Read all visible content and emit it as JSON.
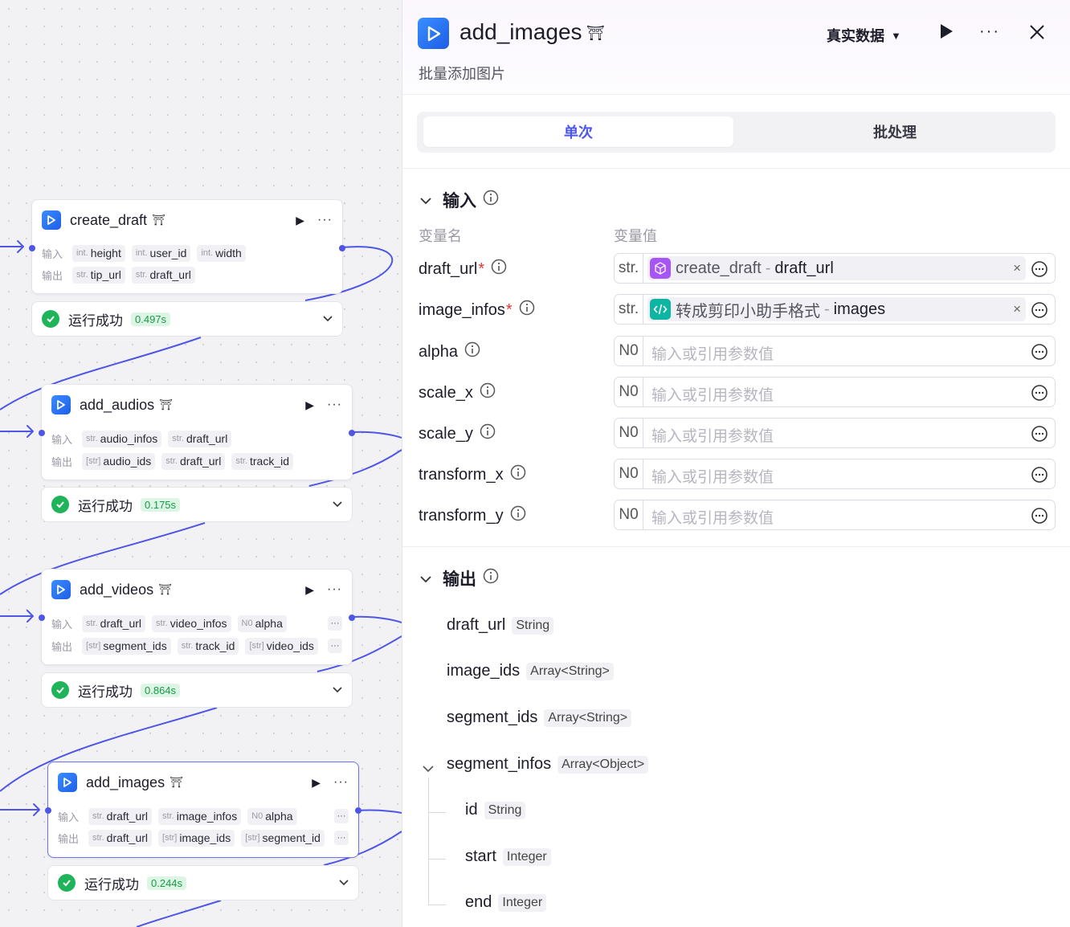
{
  "canvas": {
    "nodes": [
      {
        "title": "create_draft",
        "input_label": "输入",
        "output_label": "输出",
        "inputs": [
          {
            "type": "int.",
            "name": "height"
          },
          {
            "type": "int.",
            "name": "user_id"
          },
          {
            "type": "int.",
            "name": "width"
          }
        ],
        "outputs": [
          {
            "type": "str.",
            "name": "tip_url"
          },
          {
            "type": "str.",
            "name": "draft_url"
          }
        ],
        "status": "运行成功",
        "time": "0.497s"
      },
      {
        "title": "add_audios",
        "input_label": "输入",
        "output_label": "输出",
        "inputs": [
          {
            "type": "str.",
            "name": "audio_infos"
          },
          {
            "type": "str.",
            "name": "draft_url"
          }
        ],
        "outputs": [
          {
            "type": "[str]",
            "name": "audio_ids"
          },
          {
            "type": "str.",
            "name": "draft_url"
          },
          {
            "type": "str.",
            "name": "track_id"
          }
        ],
        "status": "运行成功",
        "time": "0.175s"
      },
      {
        "title": "add_videos",
        "input_label": "输入",
        "output_label": "输出",
        "inputs": [
          {
            "type": "str.",
            "name": "draft_url"
          },
          {
            "type": "str.",
            "name": "video_infos"
          },
          {
            "type": "N0",
            "name": "alpha"
          }
        ],
        "outputs": [
          {
            "type": "[str]",
            "name": "segment_ids"
          },
          {
            "type": "str.",
            "name": "track_id"
          },
          {
            "type": "[str]",
            "name": "video_ids"
          }
        ],
        "status": "运行成功",
        "time": "0.864s"
      },
      {
        "title": "add_images",
        "input_label": "输入",
        "output_label": "输出",
        "inputs": [
          {
            "type": "str.",
            "name": "draft_url"
          },
          {
            "type": "str.",
            "name": "image_infos"
          },
          {
            "type": "N0",
            "name": "alpha"
          }
        ],
        "outputs": [
          {
            "type": "str.",
            "name": "draft_url"
          },
          {
            "type": "[str]",
            "name": "image_ids"
          },
          {
            "type": "[str]",
            "name": "segment_id"
          }
        ],
        "status": "运行成功",
        "time": "0.244s"
      }
    ],
    "row_more": "···"
  },
  "panel": {
    "title": "add_images",
    "subtitle": "批量添加图片",
    "mode": "真实数据",
    "tabs": [
      "单次",
      "批处理"
    ],
    "input_section": "输入",
    "col_name": "变量名",
    "col_value": "变量值",
    "inputs": [
      {
        "name": "draft_url",
        "required": "*",
        "type": "str.",
        "ref_node": "create_draft",
        "ref_sep": "-",
        "ref_field": "draft_url",
        "clear": "×"
      },
      {
        "name": "image_infos",
        "required": "*",
        "type": "str.",
        "ref_node": "转成剪印小助手格式",
        "ref_sep": "-",
        "ref_field": "images",
        "clear": "×"
      },
      {
        "name": "alpha",
        "type": "N0",
        "placeholder": "输入或引用参数值"
      },
      {
        "name": "scale_x",
        "type": "N0",
        "placeholder": "输入或引用参数值"
      },
      {
        "name": "scale_y",
        "type": "N0",
        "placeholder": "输入或引用参数值"
      },
      {
        "name": "transform_x",
        "type": "N0",
        "placeholder": "输入或引用参数值"
      },
      {
        "name": "transform_y",
        "type": "N0",
        "placeholder": "输入或引用参数值"
      }
    ],
    "output_section": "输出",
    "outputs": [
      {
        "name": "draft_url",
        "type": "String"
      },
      {
        "name": "image_ids",
        "type": "Array<String>"
      },
      {
        "name": "segment_ids",
        "type": "Array<String>"
      },
      {
        "name": "segment_infos",
        "type": "Array<Object>"
      },
      {
        "name": "id",
        "type": "String"
      },
      {
        "name": "start",
        "type": "Integer"
      },
      {
        "name": "end",
        "type": "Integer"
      }
    ]
  },
  "colors": {
    "accent": "#4e56e6",
    "success": "#1fb35a",
    "required": "#e53535"
  }
}
